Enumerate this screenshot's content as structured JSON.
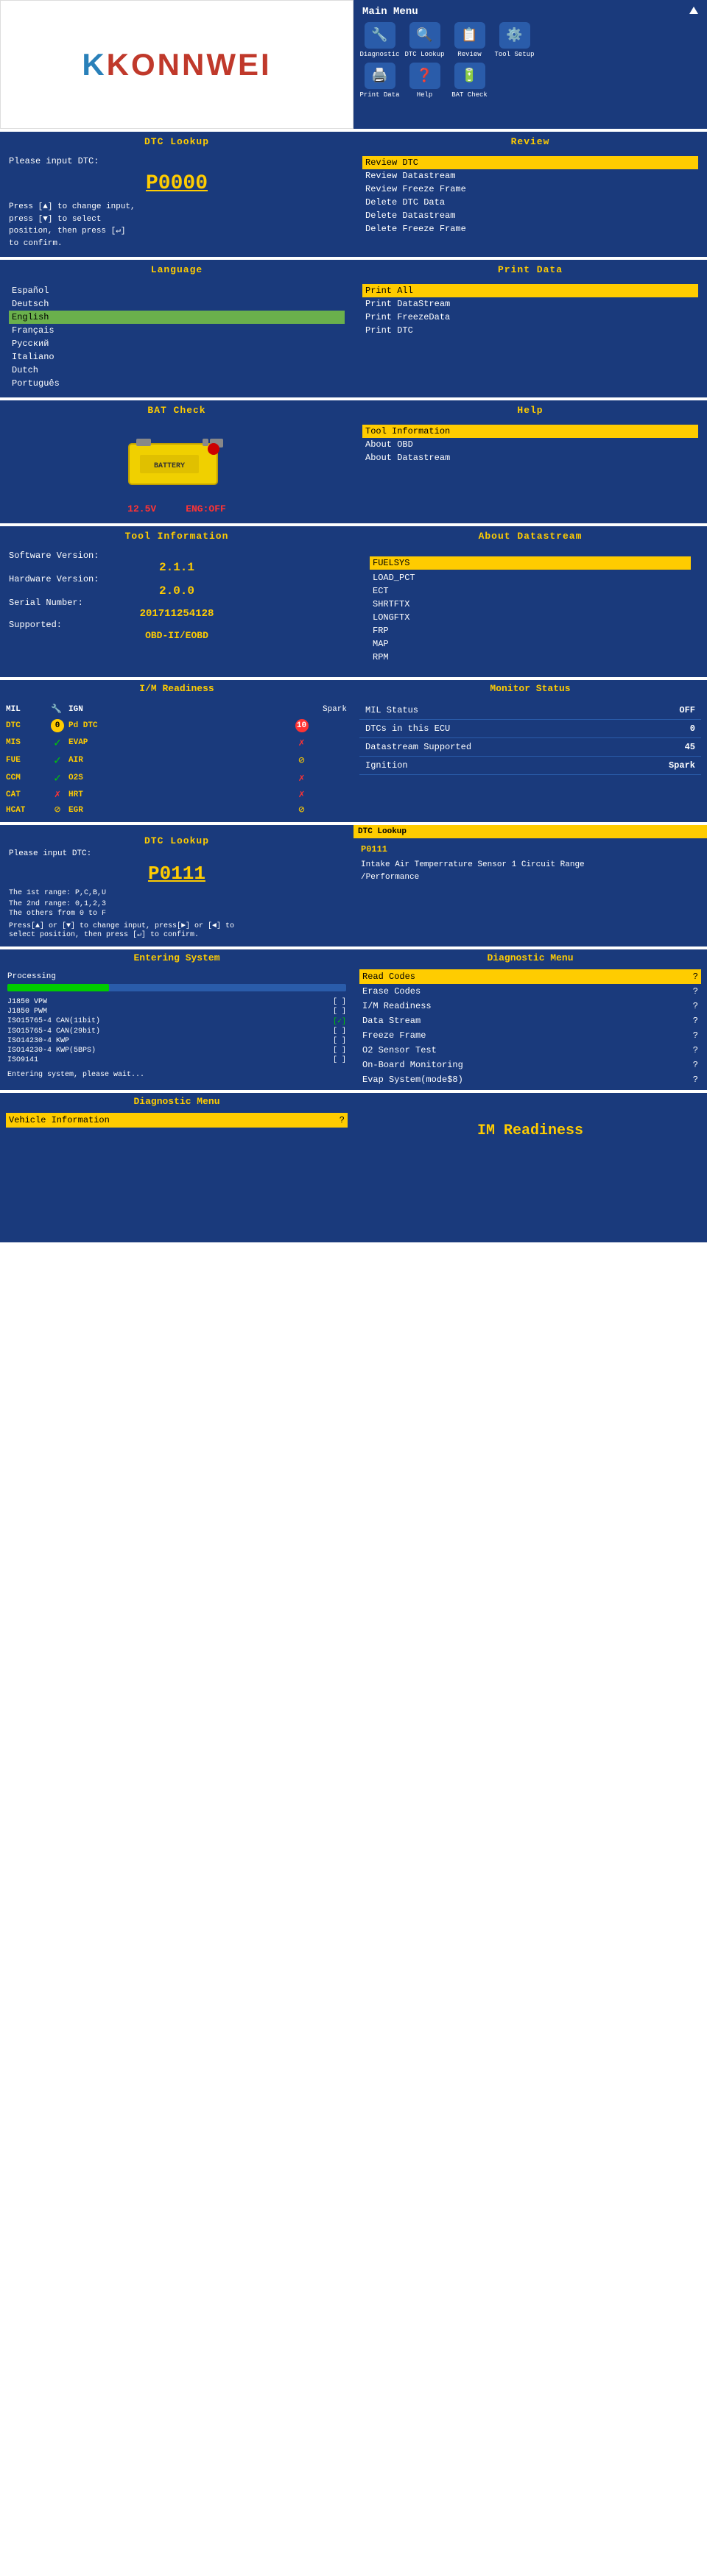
{
  "logo": {
    "text": "KONNWEI"
  },
  "main_menu": {
    "title": "Main Menu",
    "items": [
      {
        "label": "Diagnostic",
        "icon": "🔧"
      },
      {
        "label": "DTC Lookup",
        "icon": "🔍"
      },
      {
        "label": "Review",
        "icon": "📋"
      },
      {
        "label": "Tool Setup",
        "icon": "⚙️"
      },
      {
        "label": "Print Data",
        "icon": "🖨️"
      },
      {
        "label": "Help",
        "icon": "❓"
      },
      {
        "label": "BAT Check",
        "icon": "🔋"
      }
    ]
  },
  "dtc_lookup_1": {
    "title": "DTC Lookup",
    "label": "Please input DTC:",
    "code": "P0000",
    "instructions": "Press [▲] to change input,\npress [▼] to select\nposition, then press [↵]\nto confirm."
  },
  "review": {
    "title": "Review DTC",
    "items": [
      {
        "label": "Review DTC",
        "selected": true
      },
      {
        "label": "Review Datastream",
        "selected": false
      },
      {
        "label": "Review Freeze Frame",
        "selected": false
      },
      {
        "label": "Delete DTC Data",
        "selected": false
      },
      {
        "label": "Delete Datastream",
        "selected": false
      },
      {
        "label": "Delete Freeze Frame",
        "selected": false
      }
    ]
  },
  "language": {
    "title": "Language",
    "items": [
      {
        "label": "Español",
        "selected": false
      },
      {
        "label": "Deutsch",
        "selected": false
      },
      {
        "label": "English",
        "selected": true
      },
      {
        "label": "Français",
        "selected": false
      },
      {
        "label": "Русский",
        "selected": false
      },
      {
        "label": "Italiano",
        "selected": false
      },
      {
        "label": "Dutch",
        "selected": false
      },
      {
        "label": "Português",
        "selected": false
      }
    ]
  },
  "print_data": {
    "title": "Print Data",
    "items": [
      {
        "label": "Print All",
        "selected": true
      },
      {
        "label": "Print DataStream",
        "selected": false
      },
      {
        "label": "Print FreezeData",
        "selected": false
      },
      {
        "label": "Print DTC",
        "selected": false
      }
    ]
  },
  "bat_check": {
    "title": "BAT Check",
    "voltage": "12.5V",
    "engine": "ENG:",
    "engine_status": "OFF"
  },
  "help": {
    "title": "Help",
    "items": [
      {
        "label": "Tool Information",
        "selected": true
      },
      {
        "label": "About OBD",
        "selected": false
      },
      {
        "label": "About Datastream",
        "selected": false
      }
    ]
  },
  "tool_information": {
    "title": "Tool Information",
    "sw_label": "Software Version:",
    "sw_val": "2.1.1",
    "hw_label": "Hardware Version:",
    "hw_val": "2.0.0",
    "serial_label": "Serial Number:",
    "serial_val": "201711254128",
    "supported_label": "Supported:",
    "supported_val": "OBD-II/EOBD"
  },
  "about_datastream": {
    "title": "About Datastream",
    "items": [
      {
        "label": "FUELSYS",
        "selected": true
      },
      {
        "label": "LOAD_PCT",
        "selected": false
      },
      {
        "label": "ECT",
        "selected": false
      },
      {
        "label": "SHRTFTX",
        "selected": false
      },
      {
        "label": "LONGFTX",
        "selected": false
      },
      {
        "label": "FRP",
        "selected": false
      },
      {
        "label": "MAP",
        "selected": false
      },
      {
        "label": "RPM",
        "selected": false
      }
    ]
  },
  "im_readiness": {
    "title": "I/M Readiness",
    "col_headers": [
      "",
      "",
      "",
      "",
      "Spark"
    ],
    "rows": [
      {
        "col1": "MIL",
        "col2": "🔧",
        "col3": "IGN",
        "col4": "",
        "col5": "Spark"
      },
      {
        "col1": "DTC",
        "col2": "0",
        "col3": "Pd DTC",
        "col4": "10",
        "col5": ""
      },
      {
        "col1": "MIS",
        "col2": "✓",
        "col3": "EVAP",
        "col4": "✗",
        "col5": ""
      },
      {
        "col1": "FUE",
        "col2": "✓",
        "col3": "AIR",
        "col4": "⊘",
        "col5": ""
      },
      {
        "col1": "CCM",
        "col2": "✓",
        "col3": "O2S",
        "col4": "✗",
        "col5": ""
      },
      {
        "col1": "CAT",
        "col2": "✗",
        "col3": "HRT",
        "col4": "✗",
        "col5": ""
      },
      {
        "col1": "HCAT",
        "col2": "⊘",
        "col3": "EGR",
        "col4": "⊘",
        "col5": ""
      }
    ]
  },
  "monitor_status": {
    "title": "Monitor Status",
    "rows": [
      {
        "label": "MIL Status",
        "value": "OFF"
      },
      {
        "label": "DTCs in this ECU",
        "value": "0"
      },
      {
        "label": "Datastream Supported",
        "value": "45"
      },
      {
        "label": "Ignition",
        "value": "Spark"
      }
    ]
  },
  "dtc_lookup_2": {
    "title": "DTC Lookup",
    "label": "Please input DTC:",
    "code": "P0111",
    "instructions_1": "The 1st range: P,C,B,U",
    "instructions_2": "The 2nd range: 0,1,2,3",
    "instructions_3": "The others from 0 to F",
    "instructions_4": "Press[▲] or [▼] to change input, press[►] or [◄] to\nselect position, then press [↵] to confirm."
  },
  "dtc_result": {
    "title": "DTC Lookup",
    "code": "P0111",
    "description": "Intake Air Temperrature Sensor 1 Circuit Range\n/Performance"
  },
  "entering_system": {
    "title": "Entering System",
    "label": "Processing",
    "progress": 30,
    "protocols": [
      {
        "name": "J1850 VPW",
        "val": "[ ]"
      },
      {
        "name": "J1850 PWM",
        "val": "[ ]"
      },
      {
        "name": "ISO15765-4 CAN(11bit)",
        "val": "[✓]"
      },
      {
        "name": "ISO15765-4 CAN(29bit)",
        "val": "[ ]"
      },
      {
        "name": "ISO14230-4 KWP",
        "val": "[ ]"
      },
      {
        "name": "ISO14230-4 KWP(5BPS)",
        "val": "[ ]"
      },
      {
        "name": "ISO9141",
        "val": "[ ]"
      }
    ],
    "footer": "Entering system, please wait..."
  },
  "diagnostic_menu_1": {
    "title": "Diagnostic Menu",
    "items": [
      {
        "label": "Read Codes",
        "qmark": "?",
        "selected": true
      },
      {
        "label": "Erase Codes",
        "qmark": "?",
        "selected": false
      },
      {
        "label": "I/M Readiness",
        "qmark": "?",
        "selected": false
      },
      {
        "label": "Data Stream",
        "qmark": "?",
        "selected": false
      },
      {
        "label": "Freeze Frame",
        "qmark": "?",
        "selected": false
      },
      {
        "label": "O2 Sensor Test",
        "qmark": "?",
        "selected": false
      },
      {
        "label": "On-Board Monitoring",
        "qmark": "?",
        "selected": false
      },
      {
        "label": "Evap System(mode$8)",
        "qmark": "?",
        "selected": false
      }
    ]
  },
  "diagnostic_menu_bottom": {
    "title": "Diagnostic Menu",
    "items": [
      {
        "label": "Vehicle Information",
        "qmark": "?",
        "selected": true
      }
    ]
  },
  "im_readiness_bottom": {
    "title": "IM Readiness"
  }
}
